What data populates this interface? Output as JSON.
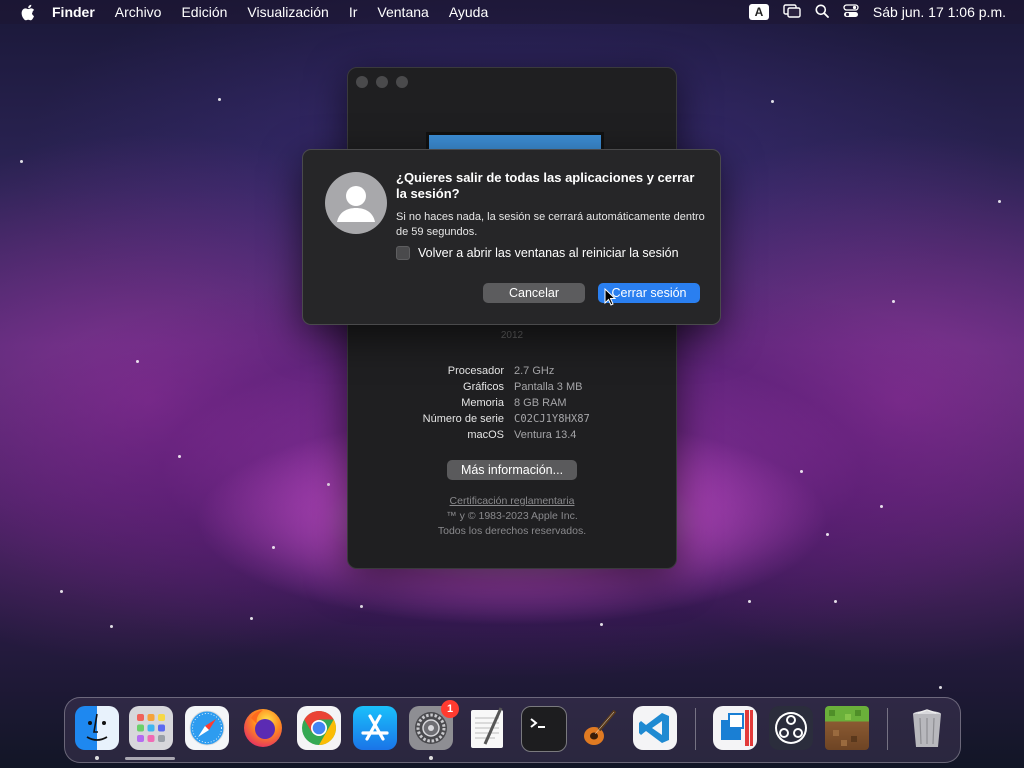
{
  "menubar": {
    "app_name": "Finder",
    "items": [
      "Archivo",
      "Edición",
      "Visualización",
      "Ir",
      "Ventana",
      "Ayuda"
    ],
    "input_source": "A",
    "datetime": "Sáb jun. 17  1:06 p.m."
  },
  "about": {
    "year": "2012",
    "specs": [
      {
        "label": "Procesador",
        "value": "2.7 GHz"
      },
      {
        "label": "Gráficos",
        "value": "Pantalla 3 MB"
      },
      {
        "label": "Memoria",
        "value": "8 GB RAM"
      },
      {
        "label": "Número de serie",
        "value": "C02CJ1Y8HX87"
      },
      {
        "label": "macOS",
        "value": "Ventura 13.4"
      }
    ],
    "more_info_label": "Más información...",
    "regulatory_link": "Certificación reglamentaria",
    "copyright": "™ y © 1983-2023 Apple Inc.",
    "rights": "Todos los derechos reservados."
  },
  "dialog": {
    "title": "¿Quieres salir de todas las aplicaciones y cerrar la sesión?",
    "message": "Si no haces nada, la sesión se cerrará automáticamente dentro de 59 segundos.",
    "checkbox_label": "Volver a abrir las ventanas al reiniciar la sesión",
    "checkbox_checked": false,
    "cancel_label": "Cancelar",
    "confirm_label": "Cerrar sesión"
  },
  "dock": {
    "apps": [
      {
        "name": "Finder",
        "icon": "finder-icon",
        "running": true
      },
      {
        "name": "Launchpad",
        "icon": "launchpad-icon",
        "running": false
      },
      {
        "name": "Safari",
        "icon": "safari-icon",
        "running": false
      },
      {
        "name": "Firefox",
        "icon": "firefox-icon",
        "running": false
      },
      {
        "name": "Chrome",
        "icon": "chrome-icon",
        "running": false
      },
      {
        "name": "App Store",
        "icon": "app-store-icon",
        "running": false
      },
      {
        "name": "Configuración del Sistema",
        "icon": "system-settings-icon",
        "running": true,
        "badge": "1"
      },
      {
        "name": "TextEdit",
        "icon": "textedit-icon",
        "running": false
      },
      {
        "name": "Terminal",
        "icon": "terminal-icon",
        "running": false
      },
      {
        "name": "GarageBand",
        "icon": "garageband-icon",
        "running": false
      },
      {
        "name": "Visual Studio Code",
        "icon": "vscode-icon",
        "running": false
      },
      {
        "name": "Parallels",
        "icon": "parallels-icon",
        "running": false
      },
      {
        "name": "OBS",
        "icon": "obs-icon",
        "running": false
      },
      {
        "name": "Minecraft",
        "icon": "minecraft-icon",
        "running": false
      },
      {
        "name": "Papelera",
        "icon": "trash-icon",
        "running": false
      }
    ]
  },
  "colors": {
    "accent_blue": "#2a7ff0",
    "dialog_bg": "#262628",
    "window_bg": "#1f1f21"
  }
}
